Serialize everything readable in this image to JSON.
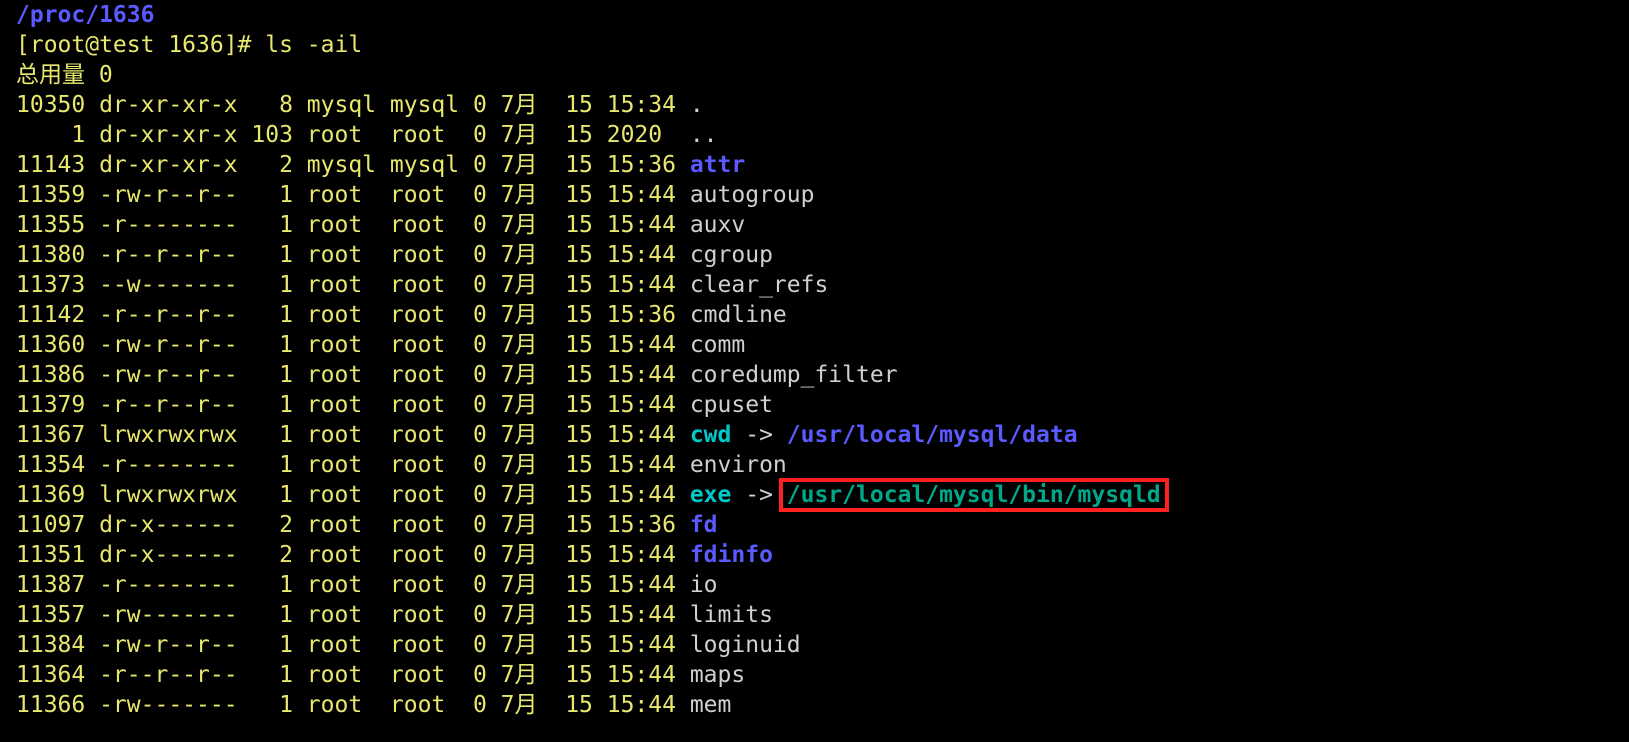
{
  "header": {
    "cwd_path": "/proc/1636",
    "prompt_prefix": "[root@test 1636]# ",
    "command": "ls -ail",
    "total_label": "总用量 0"
  },
  "cols": {
    "inode_w": 5,
    "link_w": 3,
    "owner_w": 5,
    "group_w": 5
  },
  "rows": [
    {
      "inode": "10350",
      "perm": "dr-xr-xr-x",
      "links": "8",
      "owner": "mysql",
      "group": "mysql",
      "size": "0",
      "month": "7月",
      "day": "15",
      "time": "15:34",
      "name": ".",
      "name_class": "white"
    },
    {
      "inode": "1",
      "perm": "dr-xr-xr-x",
      "links": "103",
      "owner": "root",
      "group": "root",
      "size": "0",
      "month": "7月",
      "day": "15",
      "time": "2020",
      "name": "..",
      "name_class": "white"
    },
    {
      "inode": "11143",
      "perm": "dr-xr-xr-x",
      "links": "2",
      "owner": "mysql",
      "group": "mysql",
      "size": "0",
      "month": "7月",
      "day": "15",
      "time": "15:36",
      "name": "attr",
      "name_class": "blue"
    },
    {
      "inode": "11359",
      "perm": "-rw-r--r--",
      "links": "1",
      "owner": "root",
      "group": "root",
      "size": "0",
      "month": "7月",
      "day": "15",
      "time": "15:44",
      "name": "autogroup",
      "name_class": "white"
    },
    {
      "inode": "11355",
      "perm": "-r--------",
      "links": "1",
      "owner": "root",
      "group": "root",
      "size": "0",
      "month": "7月",
      "day": "15",
      "time": "15:44",
      "name": "auxv",
      "name_class": "white"
    },
    {
      "inode": "11380",
      "perm": "-r--r--r--",
      "links": "1",
      "owner": "root",
      "group": "root",
      "size": "0",
      "month": "7月",
      "day": "15",
      "time": "15:44",
      "name": "cgroup",
      "name_class": "white"
    },
    {
      "inode": "11373",
      "perm": "--w-------",
      "links": "1",
      "owner": "root",
      "group": "root",
      "size": "0",
      "month": "7月",
      "day": "15",
      "time": "15:44",
      "name": "clear_refs",
      "name_class": "white"
    },
    {
      "inode": "11142",
      "perm": "-r--r--r--",
      "links": "1",
      "owner": "root",
      "group": "root",
      "size": "0",
      "month": "7月",
      "day": "15",
      "time": "15:36",
      "name": "cmdline",
      "name_class": "white"
    },
    {
      "inode": "11360",
      "perm": "-rw-r--r--",
      "links": "1",
      "owner": "root",
      "group": "root",
      "size": "0",
      "month": "7月",
      "day": "15",
      "time": "15:44",
      "name": "comm",
      "name_class": "white"
    },
    {
      "inode": "11386",
      "perm": "-rw-r--r--",
      "links": "1",
      "owner": "root",
      "group": "root",
      "size": "0",
      "month": "7月",
      "day": "15",
      "time": "15:44",
      "name": "coredump_filter",
      "name_class": "white"
    },
    {
      "inode": "11379",
      "perm": "-r--r--r--",
      "links": "1",
      "owner": "root",
      "group": "root",
      "size": "0",
      "month": "7月",
      "day": "15",
      "time": "15:44",
      "name": "cpuset",
      "name_class": "white"
    },
    {
      "inode": "11367",
      "perm": "lrwxrwxrwx",
      "links": "1",
      "owner": "root",
      "group": "root",
      "size": "0",
      "month": "7月",
      "day": "15",
      "time": "15:44",
      "name": "cwd",
      "name_class": "cyan",
      "arrow": " -> ",
      "target": "/usr/local/mysql/data",
      "target_class": "blue"
    },
    {
      "inode": "11354",
      "perm": "-r--------",
      "links": "1",
      "owner": "root",
      "group": "root",
      "size": "0",
      "month": "7月",
      "day": "15",
      "time": "15:44",
      "name": "environ",
      "name_class": "white"
    },
    {
      "inode": "11369",
      "perm": "lrwxrwxrwx",
      "links": "1",
      "owner": "root",
      "group": "root",
      "size": "0",
      "month": "7月",
      "day": "15",
      "time": "15:44",
      "name": "exe",
      "name_class": "cyan",
      "arrow": " -> ",
      "target": "/usr/local/mysql/bin/mysqld",
      "target_class": "teal",
      "highlight": true
    },
    {
      "inode": "11097",
      "perm": "dr-x------",
      "links": "2",
      "owner": "root",
      "group": "root",
      "size": "0",
      "month": "7月",
      "day": "15",
      "time": "15:36",
      "name": "fd",
      "name_class": "blue"
    },
    {
      "inode": "11351",
      "perm": "dr-x------",
      "links": "2",
      "owner": "root",
      "group": "root",
      "size": "0",
      "month": "7月",
      "day": "15",
      "time": "15:44",
      "name": "fdinfo",
      "name_class": "blue"
    },
    {
      "inode": "11387",
      "perm": "-r--------",
      "links": "1",
      "owner": "root",
      "group": "root",
      "size": "0",
      "month": "7月",
      "day": "15",
      "time": "15:44",
      "name": "io",
      "name_class": "white"
    },
    {
      "inode": "11357",
      "perm": "-rw-------",
      "links": "1",
      "owner": "root",
      "group": "root",
      "size": "0",
      "month": "7月",
      "day": "15",
      "time": "15:44",
      "name": "limits",
      "name_class": "white"
    },
    {
      "inode": "11384",
      "perm": "-rw-r--r--",
      "links": "1",
      "owner": "root",
      "group": "root",
      "size": "0",
      "month": "7月",
      "day": "15",
      "time": "15:44",
      "name": "loginuid",
      "name_class": "white"
    },
    {
      "inode": "11364",
      "perm": "-r--r--r--",
      "links": "1",
      "owner": "root",
      "group": "root",
      "size": "0",
      "month": "7月",
      "day": "15",
      "time": "15:44",
      "name": "maps",
      "name_class": "white"
    },
    {
      "inode": "11366",
      "perm": "-rw-------",
      "links": "1",
      "owner": "root",
      "group": "root",
      "size": "0",
      "month": "7月",
      "day": "15",
      "time": "15:44",
      "name": "mem",
      "name_class": "white"
    }
  ]
}
